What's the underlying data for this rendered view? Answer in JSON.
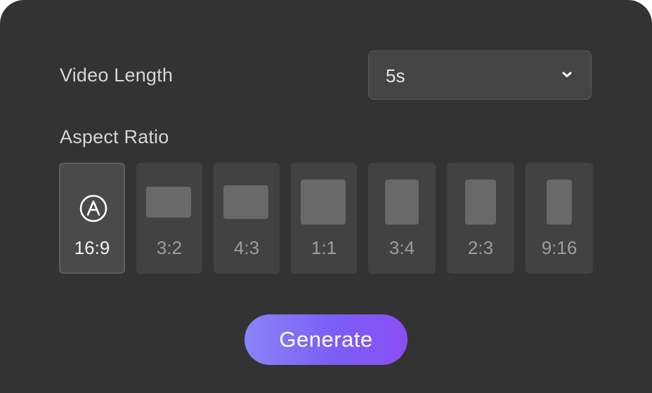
{
  "video_length": {
    "label": "Video Length",
    "selected_value": "5s",
    "dropdown_icon": "chevron-down-icon"
  },
  "aspect_ratio": {
    "label": "Aspect Ratio",
    "selected": "16:9",
    "options": [
      {
        "label": "16:9",
        "icon": "auto-icon"
      },
      {
        "label": "3:2",
        "icon": "ratio-3-2-icon"
      },
      {
        "label": "4:3",
        "icon": "ratio-4-3-icon"
      },
      {
        "label": "1:1",
        "icon": "ratio-1-1-icon"
      },
      {
        "label": "3:4",
        "icon": "ratio-3-4-icon"
      },
      {
        "label": "2:3",
        "icon": "ratio-2-3-icon"
      },
      {
        "label": "9:16",
        "icon": "ratio-9-16-icon"
      }
    ]
  },
  "generate_button": {
    "label": "Generate",
    "gradient": [
      "#8a84f7",
      "#8a4ef5"
    ]
  },
  "colors": {
    "panel_background": "#333333",
    "option_background": "#424242",
    "shape_fill": "#696969"
  }
}
